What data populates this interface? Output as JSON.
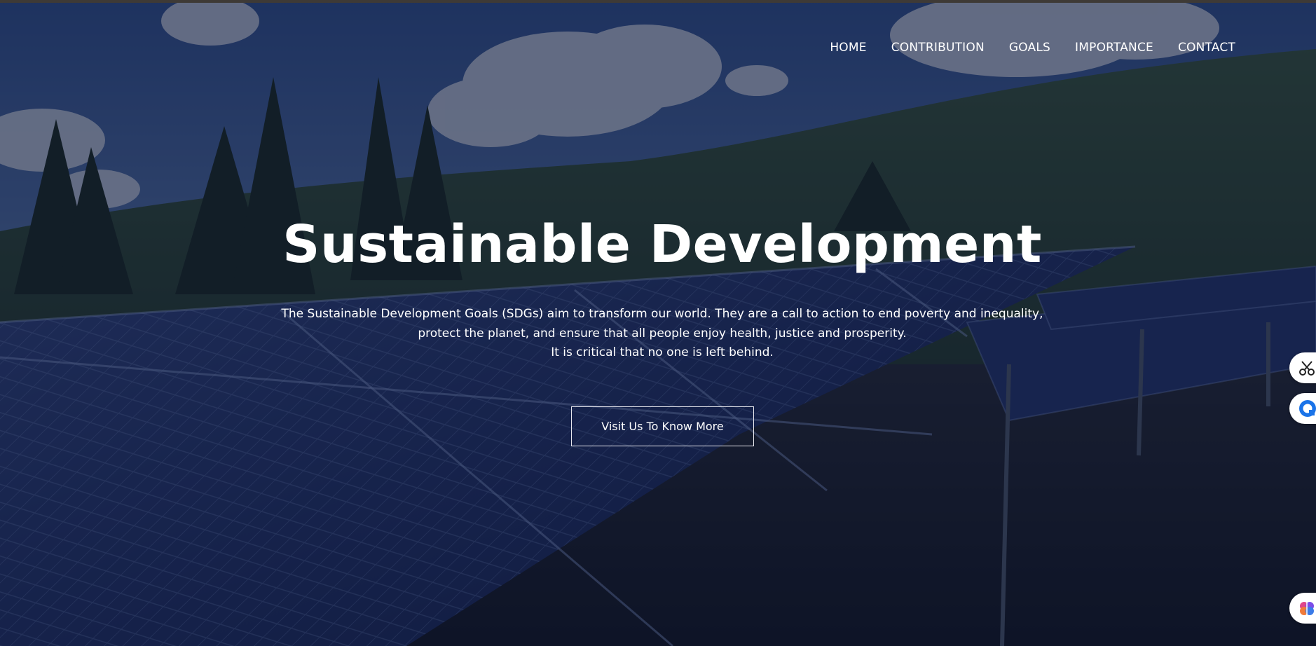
{
  "nav": {
    "items": [
      {
        "label": "HOME"
      },
      {
        "label": "CONTRIBUTION"
      },
      {
        "label": "GOALS"
      },
      {
        "label": "IMPORTANCE"
      },
      {
        "label": "CONTACT"
      }
    ]
  },
  "hero": {
    "title": "Sustainable Development",
    "description_lines": [
      "The Sustainable Development Goals (SDGs) aim to transform our world. They are a call to action to end poverty and inequality,",
      "protect the planet, and ensure that all people enjoy health, justice and prosperity.",
      "It is critical that no one is left behind."
    ],
    "cta_label": "Visit Us To Know More",
    "background_icon": "solar-panel-field-photo"
  },
  "extension_buttons": [
    {
      "icon": "scissors-icon"
    },
    {
      "icon": "chat-bubble-icon"
    },
    {
      "icon": "brain-icon"
    }
  ],
  "colors": {
    "overlay": "#0b1433",
    "text": "#ffffff",
    "button_border": "#e8e8ee"
  }
}
